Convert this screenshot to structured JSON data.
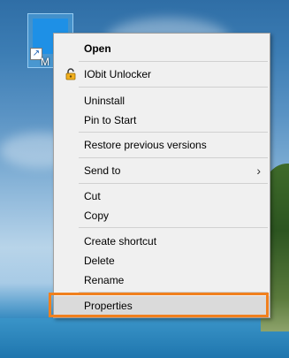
{
  "desktop": {
    "icon_label": "M"
  },
  "context_menu": {
    "items": [
      {
        "label": "Open"
      },
      {
        "label": "IObit Unlocker",
        "icon": "iobit-unlocker-icon"
      },
      {
        "label": "Uninstall"
      },
      {
        "label": "Pin to Start"
      },
      {
        "label": "Restore previous versions"
      },
      {
        "label": "Send to",
        "submenu_icon": "chevron-right-icon"
      },
      {
        "label": "Cut"
      },
      {
        "label": "Copy"
      },
      {
        "label": "Create shortcut"
      },
      {
        "label": "Delete"
      },
      {
        "label": "Rename"
      },
      {
        "label": "Properties"
      }
    ],
    "submenu_glyph": "›"
  },
  "colors": {
    "menu_background": "#f0f0f0",
    "highlight_border": "#f0801e",
    "hover_background": "#dadada"
  }
}
